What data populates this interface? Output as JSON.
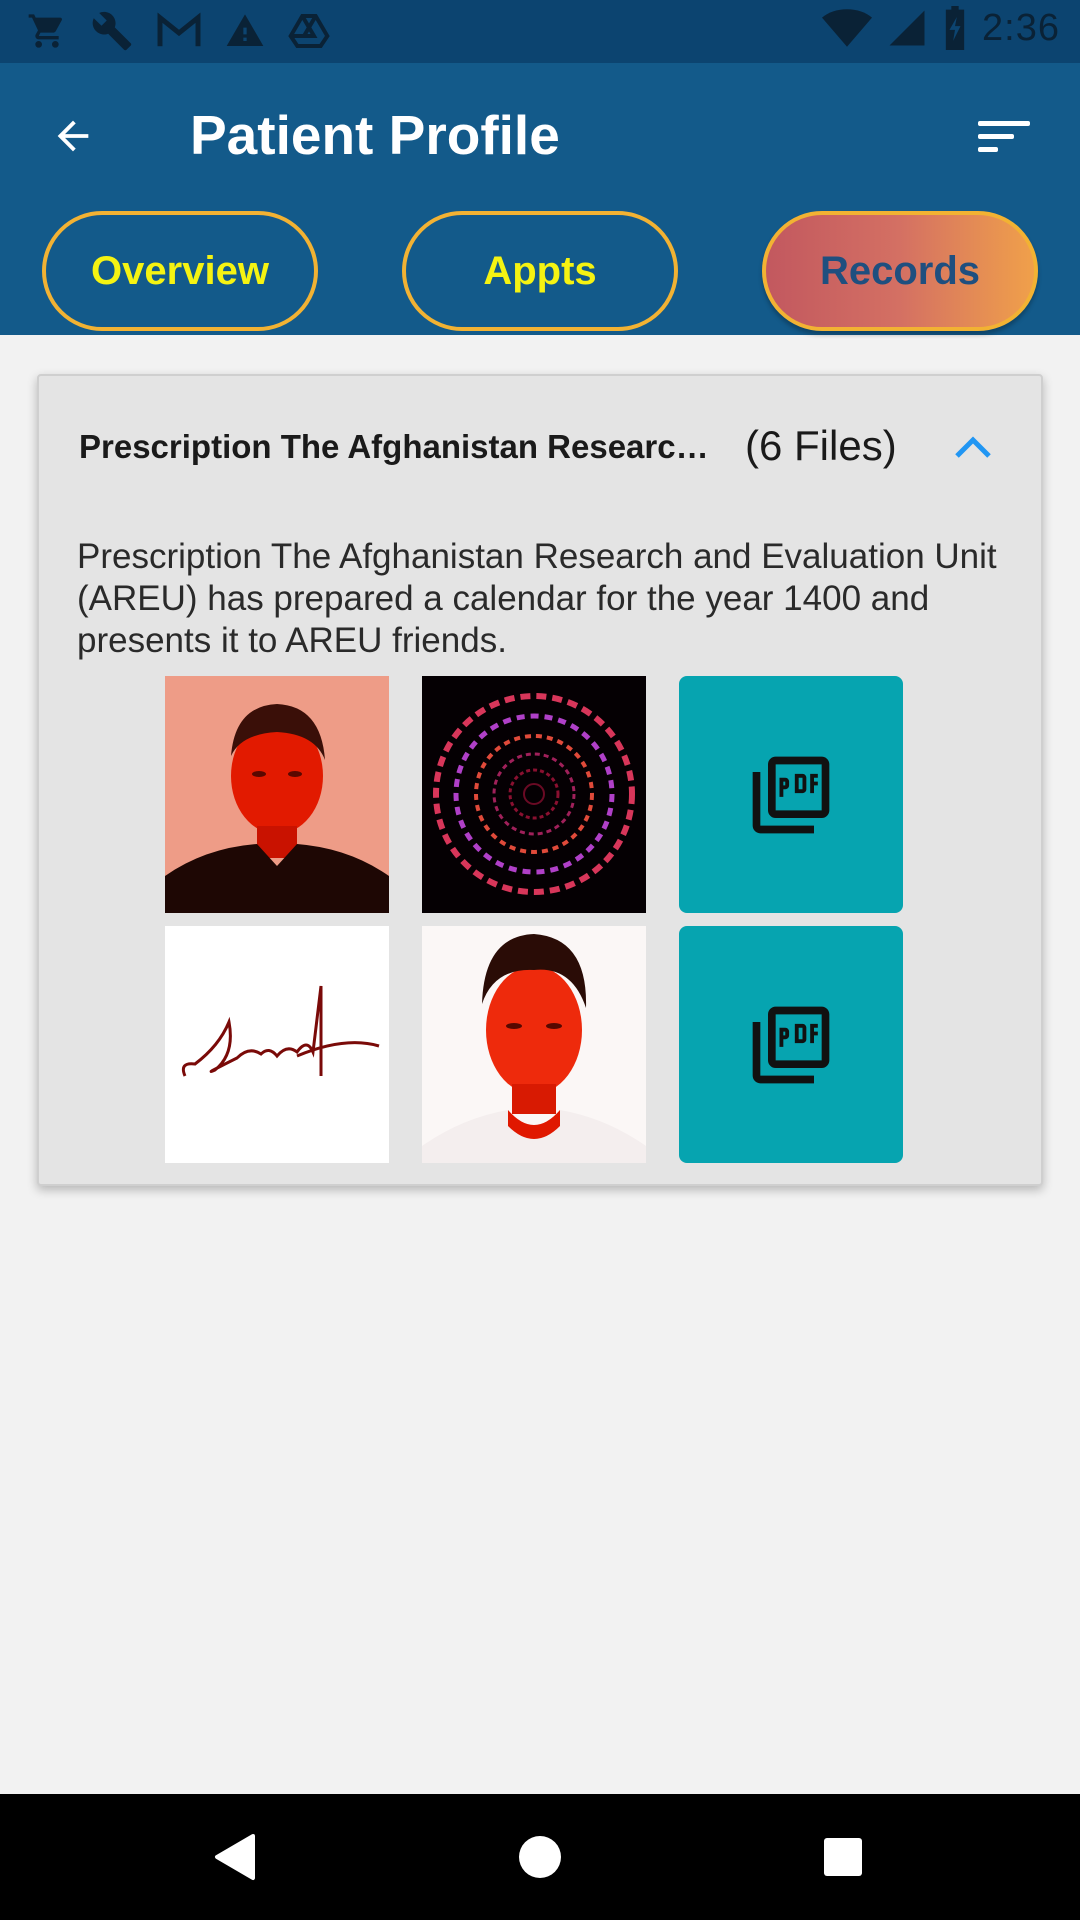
{
  "status_bar": {
    "time": "2:36",
    "left_icons": [
      "cart-icon",
      "wrench-icon",
      "gmail-icon",
      "warning-icon",
      "drive-icon"
    ],
    "right_icons": [
      "wifi-icon",
      "signal-icon",
      "battery-icon"
    ]
  },
  "app_bar": {
    "title": "Patient Profile",
    "back_icon": "arrow-left-icon",
    "filter_icon": "sort-icon"
  },
  "tabs": [
    {
      "label": "Overview",
      "active": false
    },
    {
      "label": "Appts",
      "active": false
    },
    {
      "label": "Records",
      "active": true
    }
  ],
  "record": {
    "title": "Prescription The Afghanistan Research and Evaluation Unit (AREU) has prepared a calendar for the year 1400",
    "files_count": "(6 Files)",
    "expanded": true,
    "description": "Prescription The Afghanistan Research and Evaluation Unit (AREU) has prepared a calendar for the year 1400 and presents it to AREU friends.",
    "files": [
      {
        "type": "image",
        "name": "portrait-photo-1"
      },
      {
        "type": "image",
        "name": "spiral-numbers-image"
      },
      {
        "type": "pdf",
        "name": "pdf-file-1"
      },
      {
        "type": "image",
        "name": "signature-image"
      },
      {
        "type": "image",
        "name": "portrait-photo-2"
      },
      {
        "type": "pdf",
        "name": "pdf-file-2"
      }
    ]
  },
  "nav_bar": {
    "items": [
      "back-triangle-icon",
      "home-circle-icon",
      "recents-square-icon"
    ]
  },
  "colors": {
    "status_bar": "#0c4470",
    "app_bar": "#135a8a",
    "tab_border": "#f2b233",
    "tab_text": "#f5f312",
    "active_tab_text": "#1f4f7f",
    "pdf_tile": "#06a4b0",
    "chevron": "#2196f3"
  }
}
